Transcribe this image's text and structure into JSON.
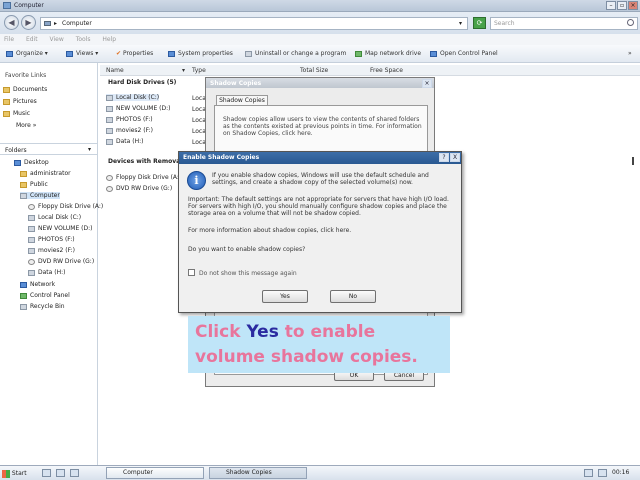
{
  "window": {
    "title": "Computer"
  },
  "address_bar": {
    "path": "Computer",
    "search_placeholder": "Search"
  },
  "menu": [
    "File",
    "Edit",
    "View",
    "Tools",
    "Help"
  ],
  "toolbar": [
    "Organize",
    "Views",
    "Properties",
    "System properties",
    "Uninstall or change a program",
    "Map network drive",
    "Open Control Panel"
  ],
  "favorites": {
    "header": "Favorite Links",
    "items": [
      "Documents",
      "Pictures",
      "Music",
      "More"
    ]
  },
  "folders": {
    "header": "Folders",
    "items": [
      "Desktop",
      "administrator",
      "Public",
      "Computer",
      "Floppy Disk Drive (A:)",
      "Local Disk (C:)",
      "NEW VOLUME (D:)",
      "PHOTOS (F:)",
      "movies2 (F:)",
      "DVD RW Drive (G:)",
      "Data (H:)",
      "Network",
      "Control Panel",
      "Recycle Bin"
    ]
  },
  "columns": [
    "Name",
    "Type",
    "Total Size",
    "Free Space"
  ],
  "content": {
    "hdd_group": "Hard Disk Drives (5)",
    "hdd": [
      "Local Disk (C:)",
      "NEW VOLUME (D:)",
      "PHOTOS (F:)",
      "movies2 (F:)",
      "Data (H:)"
    ],
    "hdd_type": [
      "Local",
      "Local",
      "Local",
      "Local",
      "Local"
    ],
    "removable_group": "Devices with Removable Storage",
    "removable": [
      "Floppy Disk Drive (A:)",
      "DVD RW Drive (G:)"
    ]
  },
  "shadow_dialog": {
    "title": "Shadow Copies",
    "tab": "Shadow Copies",
    "description": "Shadow copies allow users to view the contents of shared folders as the contents existed at previous points in time. For information on Shadow Copies, click here.",
    "ok": "OK",
    "cancel": "Cancel"
  },
  "enable_dialog": {
    "title": "Enable Shadow Copies",
    "help": "?",
    "close": "X",
    "line1": "If you enable shadow copies, Windows will use the default schedule and settings, and create a shadow copy of the selected volume(s) now.",
    "line2": "Important: The default settings are not appropriate for servers that have high I/O load. For servers with high I/O, you should manually configure shadow copies and place the storage area on a volume that will not be shadow copied.",
    "line3": "For more information about shadow copies, click here.",
    "question": "Do you want to enable shadow copies?",
    "checkbox": "Do not show this message again",
    "yes": "Yes",
    "no": "No"
  },
  "callout": {
    "prefix": "Click",
    "keyword": "Yes",
    "suffix": "to enable",
    "line2": "volume shadow copies."
  },
  "taskbar": {
    "start": "Start",
    "items": [
      "Computer",
      "Shadow Copies"
    ],
    "clock": "00:16"
  }
}
